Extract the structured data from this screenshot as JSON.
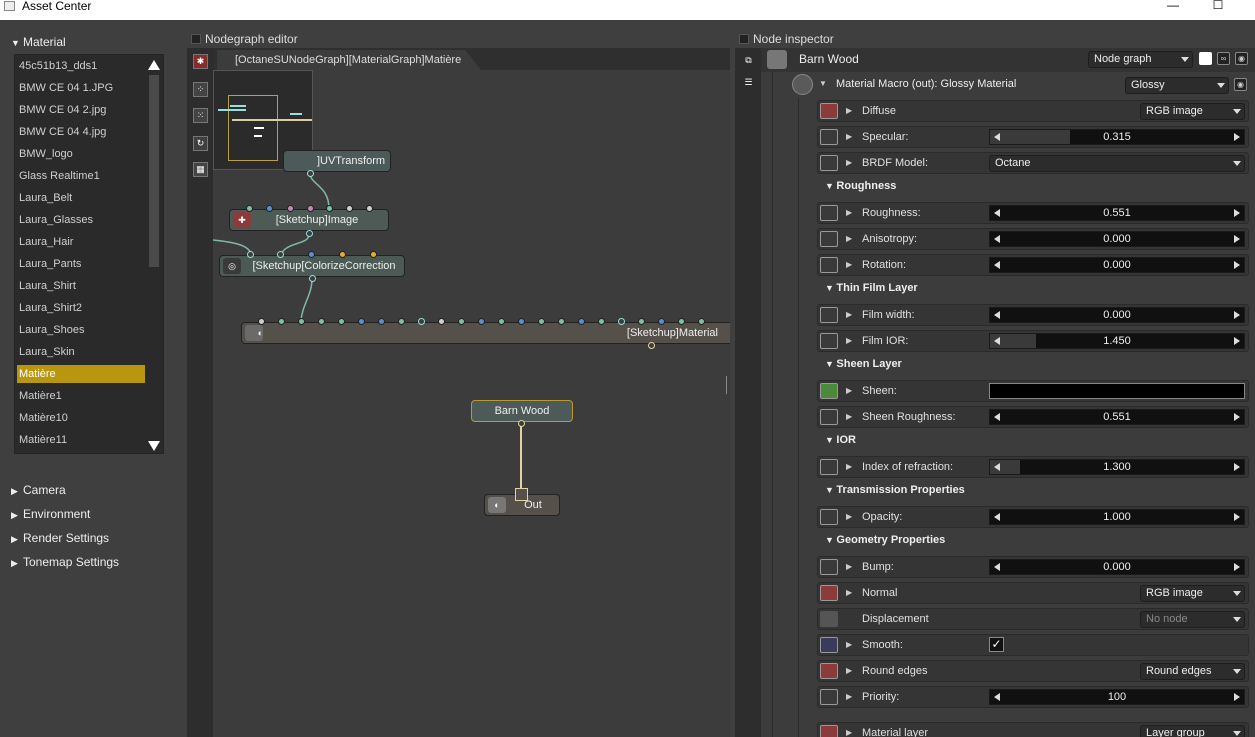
{
  "titlebar": {
    "title": "Asset Center",
    "minimize": "—",
    "maximize": "☐"
  },
  "left": {
    "material_header": "Material",
    "materials": [
      "45c51b13_dds1",
      "BMW CE 04 1.JPG",
      "BMW CE 04 2.jpg",
      "BMW CE 04 4.jpg",
      "BMW_logo",
      "Glass Realtime1",
      "Laura_Belt",
      "Laura_Glasses",
      "Laura_Hair",
      "Laura_Pants",
      "Laura_Shirt",
      "Laura_Shirt2",
      "Laura_Shoes",
      "Laura_Skin",
      "Matière",
      "Matière1",
      "Matière10",
      "Matière11"
    ],
    "selected_index": 14,
    "sections": [
      "Camera",
      "Environment",
      "Render Settings",
      "Tonemap Settings"
    ]
  },
  "nodegraph": {
    "panel_title": "Nodegraph editor",
    "tab": "[OctaneSUNodeGraph][MaterialGraph]Matière",
    "nodes": {
      "uvtransform": "]UVTransform",
      "image": "[Sketchup]Image",
      "colorize": "[Sketchup[ColorizeCorrection",
      "material": "[Sketchup]Material",
      "barnwood": "Barn Wood",
      "out": "Out"
    }
  },
  "inspector": {
    "panel_title": "Node inspector",
    "node_name": "Barn Wood",
    "node_graph_combo": "Node graph",
    "macro_label": "Material Macro (out): Glossy Material",
    "macro_type": "Glossy",
    "rows": [
      {
        "label": "Diffuse",
        "kind": "combo",
        "value": "RGB image"
      },
      {
        "label": "Specular:",
        "kind": "slider",
        "value": "0.315",
        "fill": 0.315
      },
      {
        "label": "BRDF Model:",
        "kind": "wide",
        "value": "Octane"
      },
      {
        "group": "Roughness"
      },
      {
        "label": "Roughness:",
        "kind": "slider",
        "value": "0.551",
        "fill": 0.0
      },
      {
        "label": "Anisotropy:",
        "kind": "slider",
        "value": "0.000",
        "fill": 0.0
      },
      {
        "label": "Rotation:",
        "kind": "slider",
        "value": "0.000",
        "fill": 0.0
      },
      {
        "group": "Thin Film Layer"
      },
      {
        "label": "Film width:",
        "kind": "slider",
        "value": "0.000",
        "fill": 0.0
      },
      {
        "label": "Film IOR:",
        "kind": "slider",
        "value": "1.450",
        "fill": 0.18
      },
      {
        "group": "Sheen Layer"
      },
      {
        "label": "Sheen:",
        "kind": "color",
        "value": ""
      },
      {
        "label": "Sheen Roughness:",
        "kind": "slider",
        "value": "0.551",
        "fill": 0.0
      },
      {
        "group": "IOR"
      },
      {
        "label": "Index of refraction:",
        "kind": "slider",
        "value": "1.300",
        "fill": 0.12
      },
      {
        "group": "Transmission Properties"
      },
      {
        "label": "Opacity:",
        "kind": "slider",
        "value": "1.000",
        "fill": 0.0
      },
      {
        "group": "Geometry Properties"
      },
      {
        "label": "Bump:",
        "kind": "slider",
        "value": "0.000",
        "fill": 0.0
      },
      {
        "label": "Normal",
        "kind": "combo",
        "value": "RGB image"
      },
      {
        "label": "Displacement",
        "kind": "nocombo",
        "value": "No node"
      },
      {
        "label": "Smooth:",
        "kind": "check",
        "value": "✓"
      },
      {
        "label": "Round edges",
        "kind": "combo",
        "value": "Round edges"
      },
      {
        "label": "Priority:",
        "kind": "slider",
        "value": "100",
        "fill": 0.0
      },
      {
        "label": "Material layer",
        "kind": "combo",
        "value": "Layer group"
      }
    ]
  },
  "colors": {
    "accent": "#b8960f",
    "panel": "#3f3f3f"
  }
}
